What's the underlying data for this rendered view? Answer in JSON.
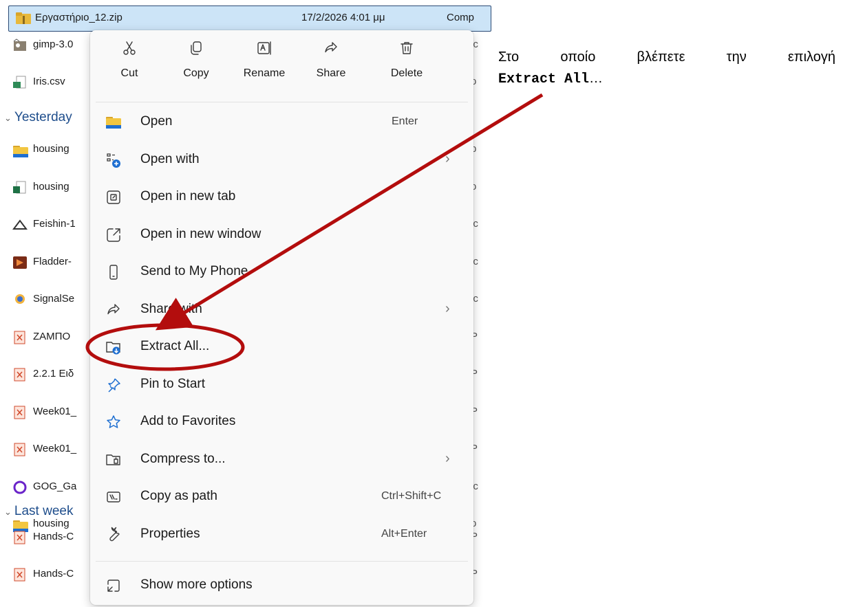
{
  "explorer": {
    "selected_file": {
      "name": "Εργαστήριο_12.zip",
      "date": "17/2/2026 4:01 μμ",
      "type": "Comp"
    },
    "files_today": [
      {
        "name": "gimp-3.0",
        "icon": "gimp-icon",
        "right": "ic"
      },
      {
        "name": "Iris.csv",
        "icon": "csv-file-icon",
        "right": "o"
      }
    ],
    "group_yesterday": "Yesterday",
    "files_yesterday": [
      {
        "name": "housing",
        "icon": "folder-icon",
        "right": "p"
      },
      {
        "name": "housing",
        "icon": "excel-file-icon",
        "right": "o"
      },
      {
        "name": "Feishin-1",
        "icon": "feishin-app-icon",
        "right": "ic"
      },
      {
        "name": "Fladder-",
        "icon": "fladder-app-icon",
        "right": "ic"
      },
      {
        "name": "SignalSe",
        "icon": "signal-app-icon",
        "right": "ic"
      },
      {
        "name": "ΖΑΜΠΟ",
        "icon": "pdf-file-icon",
        "right": "P"
      },
      {
        "name": "2.2.1 Ειδ",
        "icon": "pdf-file-icon",
        "right": "P"
      },
      {
        "name": "Week01_",
        "icon": "pdf-file-icon",
        "right": "P"
      },
      {
        "name": "Week01_",
        "icon": "pdf-file-icon",
        "right": "P"
      },
      {
        "name": "GOG_Ga",
        "icon": "gog-app-icon",
        "right": "ic"
      },
      {
        "name": "housing",
        "icon": "folder-icon",
        "right": "o"
      }
    ],
    "group_last_week": "Last week",
    "files_last_week": [
      {
        "name": "Hands-C",
        "icon": "pdf-file-icon",
        "right": "P"
      },
      {
        "name": "Hands-C",
        "icon": "pdf-file-icon",
        "right": "P"
      }
    ]
  },
  "context_menu": {
    "quick_actions": [
      {
        "label": "Cut",
        "icon": "scissors-icon"
      },
      {
        "label": "Copy",
        "icon": "copy-icon"
      },
      {
        "label": "Rename",
        "icon": "rename-icon"
      },
      {
        "label": "Share",
        "icon": "share-icon"
      },
      {
        "label": "Delete",
        "icon": "trash-icon"
      }
    ],
    "items": [
      {
        "label": "Open",
        "icon": "folder-icon",
        "shortcut": "Enter",
        "submenu": false
      },
      {
        "label": "Open with",
        "icon": "open-with-icon",
        "shortcut": "",
        "submenu": true
      },
      {
        "label": "Open in new tab",
        "icon": "new-tab-icon",
        "shortcut": "",
        "submenu": false
      },
      {
        "label": "Open in new window",
        "icon": "new-window-icon",
        "shortcut": "",
        "submenu": false
      },
      {
        "label": "Send to My Phone",
        "icon": "phone-icon",
        "shortcut": "",
        "submenu": false
      },
      {
        "label": "Share with",
        "icon": "share-icon",
        "shortcut": "",
        "submenu": true
      },
      {
        "label": "Extract All...",
        "icon": "extract-icon",
        "shortcut": "",
        "submenu": false
      },
      {
        "label": "Pin to Start",
        "icon": "pin-icon",
        "shortcut": "",
        "submenu": false
      },
      {
        "label": "Add to Favorites",
        "icon": "star-icon",
        "shortcut": "",
        "submenu": false
      },
      {
        "label": "Compress to...",
        "icon": "compress-icon",
        "shortcut": "",
        "submenu": true
      },
      {
        "label": "Copy as path",
        "icon": "copy-path-icon",
        "shortcut": "Ctrl+Shift+C",
        "submenu": false
      },
      {
        "label": "Properties",
        "icon": "wrench-icon",
        "shortcut": "Alt+Enter",
        "submenu": false
      },
      {
        "label": "Show more options",
        "icon": "more-options-icon",
        "shortcut": "",
        "submenu": false
      }
    ],
    "submenu_glyph": "›"
  },
  "annotation": {
    "line1_words": [
      "Στο",
      "οποίο",
      "βλέπετε",
      "την",
      "επιλογή"
    ],
    "bold_text": "Extract All",
    "ellipsis": "…",
    "arrow_color": "#b30d0d"
  }
}
